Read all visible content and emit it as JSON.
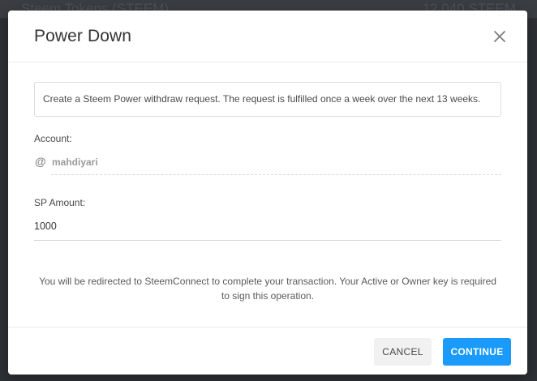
{
  "background": {
    "left_text": "Steem Tokens (STEEM)",
    "right_text": "12,040 STEEM"
  },
  "modal": {
    "title": "Power Down",
    "close_icon": "close-icon",
    "info_text": "Create a Steem Power withdraw request. The request is fulfilled once a week over the next 13 weeks.",
    "account_label": "Account:",
    "account_prefix": "@",
    "account_value": "mahdiyari",
    "sp_amount_label": "SP Amount:",
    "sp_amount_value": "1000",
    "redirect_text": "You will be redirected to SteemConnect to complete your transaction. Your Active or Owner key is required to sign this operation.",
    "cancel_label": "CANCEL",
    "continue_label": "CONTINUE"
  },
  "colors": {
    "primary": "#1a9bfb",
    "overlay": "#2d3035"
  }
}
